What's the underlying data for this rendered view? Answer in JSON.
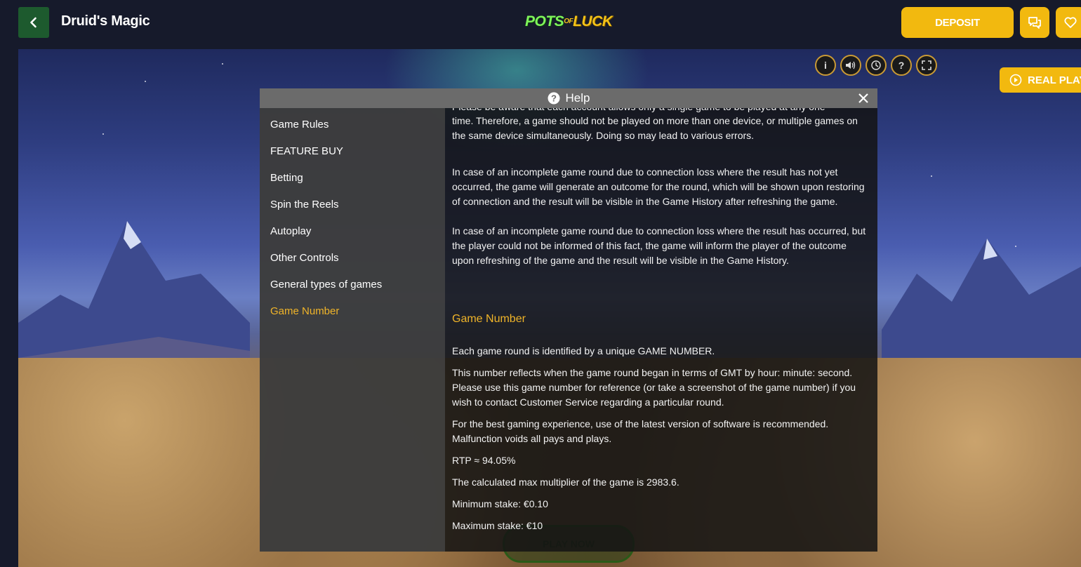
{
  "header": {
    "game_title": "Druid's Magic",
    "logo_pots": "POTS",
    "logo_of": "OF",
    "logo_luck": "LUCK",
    "deposit_label": "DEPOSIT"
  },
  "game": {
    "real_play_label": "REAL PLAY",
    "play_now_label": "PLAY NOW"
  },
  "help": {
    "title": "Help",
    "nav": [
      {
        "label": "Game Rules"
      },
      {
        "label": "FEATURE BUY"
      },
      {
        "label": "Betting"
      },
      {
        "label": "Spin the Reels"
      },
      {
        "label": "Autoplay"
      },
      {
        "label": "Other Controls"
      },
      {
        "label": "General types of games"
      },
      {
        "label": "Game Number"
      }
    ],
    "active_nav": "Game Number",
    "content": {
      "cut_line": "Please be aware that each account allows only a single game to be played at any one",
      "p1": "time. Therefore, a game should not be played on more than one device, or multiple games on the same device simultaneously. Doing so may lead to various errors.",
      "p2": "In case of an incomplete game round due to connection loss where the result has not yet occurred, the game will generate an outcome for the round, which will be shown upon restoring of connection and the result will be visible in the Game History after refreshing the game.",
      "p3": "In case of an incomplete game round due to connection loss where the result has occurred, but the player could not be informed of this fact, the game will inform the player of the outcome upon refreshing of the game and the result will be visible in the Game History.",
      "section_title": "Game Number",
      "p4": "Each game round is identified by a unique GAME NUMBER.",
      "p5": "This number reflects when the game round began in terms of GMT by hour: minute: second. Please use this game number for reference (or take a screenshot of the game number) if you wish to contact Customer Service regarding a particular round.",
      "p6": "For the best gaming experience, use of the latest version of software is recommended. Malfunction voids all pays and plays.",
      "rtp": "RTP ≈ 94.05%",
      "max_multiplier": "The calculated max multiplier of the game is 2983.6.",
      "min_stake": "Minimum stake: €0.10",
      "max_stake": "Maximum stake: €10"
    }
  },
  "colors": {
    "accent": "#f2b90f",
    "active_nav": "#f0b429",
    "back_button": "#1d5a2e",
    "topbar": "#161a2b"
  }
}
